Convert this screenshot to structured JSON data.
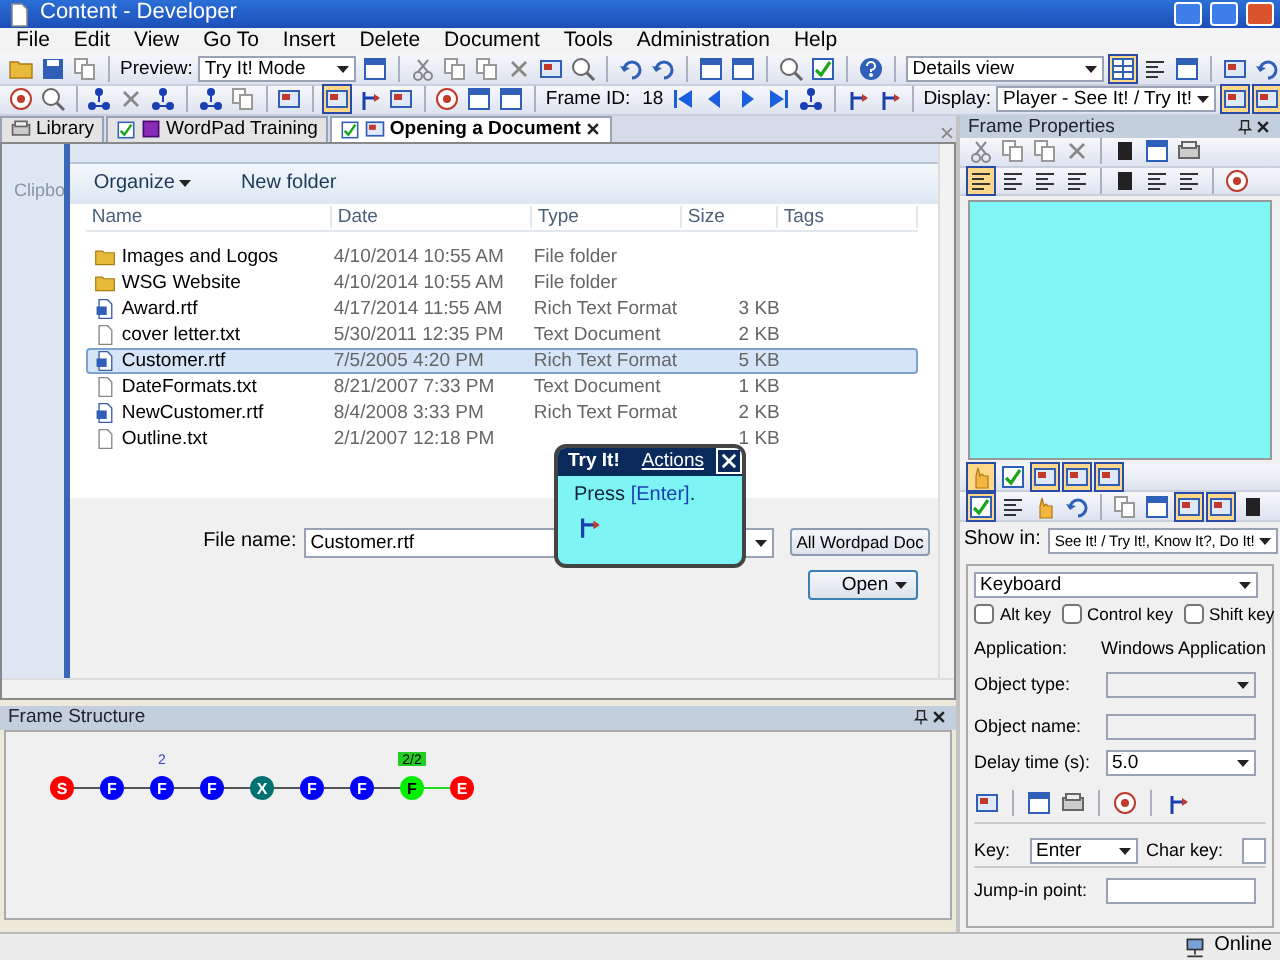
{
  "window": {
    "title": "Content - Developer"
  },
  "menu": [
    "File",
    "Edit",
    "View",
    "Go To",
    "Insert",
    "Delete",
    "Document",
    "Tools",
    "Administration",
    "Help"
  ],
  "toolbar": {
    "preview_label": "Preview:",
    "preview_mode": "Try It! Mode",
    "view_mode": "Details view",
    "frame_id_label": "Frame ID:",
    "frame_id": "18",
    "display_label": "Display:",
    "display_mode": "Player - See It! / Try It!"
  },
  "tabs": [
    {
      "label": "Library",
      "kind": "library",
      "checked": false,
      "selected": false
    },
    {
      "label": "WordPad Training",
      "kind": "module",
      "checked": true,
      "selected": false
    },
    {
      "label": "Opening a Document",
      "kind": "topic",
      "checked": true,
      "selected": true
    }
  ],
  "screenshot": {
    "ribbon_label": "Clipbo",
    "organize": "Organize",
    "new_folder": "New folder",
    "columns": [
      "Name",
      "Date",
      "Type",
      "Size",
      "Tags"
    ],
    "rows": [
      {
        "kind": "folder",
        "name": "Images and Logos",
        "date": "4/10/2014 10:55 AM",
        "type": "File folder",
        "selected": false
      },
      {
        "kind": "folder",
        "name": "WSG Website",
        "date": "4/10/2014 10:55 AM",
        "type": "File folder",
        "selected": false
      },
      {
        "kind": "rtf",
        "name": "Award.rtf",
        "date": "4/17/2014 11:55 AM",
        "type": "Rich Text Format",
        "size": "3 KB",
        "selected": false
      },
      {
        "kind": "txt",
        "name": "cover letter.txt",
        "date": "5/30/2011 12:35 PM",
        "type": "Text Document",
        "size": "2 KB",
        "selected": false
      },
      {
        "kind": "rtf",
        "name": "Customer.rtf",
        "date": "7/5/2005 4:20 PM",
        "type": "Rich Text Format",
        "size": "5 KB",
        "selected": true
      },
      {
        "kind": "txt",
        "name": "DateFormats.txt",
        "date": "8/21/2007 7:33 PM",
        "type": "Text Document",
        "size": "1 KB",
        "selected": false
      },
      {
        "kind": "rtf",
        "name": "NewCustomer.rtf",
        "date": "8/4/2008 3:33 PM",
        "type": "Rich Text Format",
        "size": "2 KB",
        "selected": false
      },
      {
        "kind": "txt",
        "name": "Outline.txt",
        "date": "2/1/2007 12:18 PM",
        "size": "1 KB",
        "selected": false
      }
    ],
    "file_name_label": "File name:",
    "file_name": "Customer.rtf",
    "filter": "All Wordpad Doc",
    "open": "Open"
  },
  "bubble": {
    "title": "Try It!",
    "actions": "Actions",
    "text_before": "Press ",
    "key": "[Enter]",
    "text_after": "."
  },
  "frame_structure": {
    "title": "Frame Structure",
    "nodes": [
      {
        "letter": "S",
        "color": "#ff0000"
      },
      {
        "letter": "F",
        "color": "#0000ff"
      },
      {
        "letter": "F",
        "color": "#0000ff",
        "note": "2"
      },
      {
        "letter": "F",
        "color": "#0000ff"
      },
      {
        "letter": "X",
        "color": "#007070"
      },
      {
        "letter": "F",
        "color": "#0000ff"
      },
      {
        "letter": "F",
        "color": "#0000ff"
      },
      {
        "letter": "F",
        "color": "#00ee00",
        "note": "2/2"
      },
      {
        "letter": "E",
        "color": "#ff0000"
      }
    ]
  },
  "frame_properties": {
    "title": "Frame Properties",
    "show_in_label": "Show in:",
    "show_in": "See It! / Try It!, Know It?, Do It!",
    "action": "Keyboard",
    "modifiers": [
      {
        "label": "Alt key",
        "checked": false
      },
      {
        "label": "Control key",
        "checked": false
      },
      {
        "label": "Shift key",
        "checked": false
      }
    ],
    "application_label": "Application:",
    "application": "Windows Application",
    "object_type_label": "Object type:",
    "object_type": {
      "disabled": true
    },
    "object_name_label": "Object name:",
    "object_name": {
      "disabled": true
    },
    "delay_label": "Delay time (s):",
    "delay": "5.0",
    "key_label": "Key:",
    "key": "Enter",
    "char_key_label": "Char key:",
    "jump_in_label": "Jump-in point:"
  },
  "status_bar": {
    "text": "Online"
  }
}
